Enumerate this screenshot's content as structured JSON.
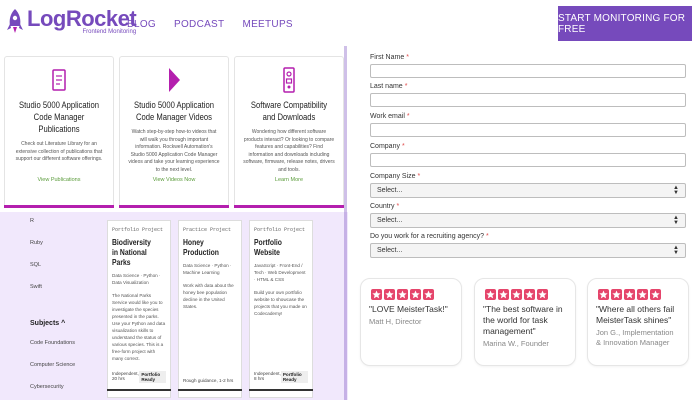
{
  "header": {
    "logo_name": "LogRocket",
    "logo_sub": "Frontend Monitoring",
    "nav": [
      "BLOG",
      "PODCAST",
      "MEETUPS"
    ],
    "cta": "START MONITORING FOR FREE"
  },
  "resource_cards": [
    {
      "icon": "document-icon",
      "title": "Studio 5000 Application Code Manager Publications",
      "desc": "Check out Literature Library for an extensive collection of publications that support our different software offerings.",
      "link": "View Publications"
    },
    {
      "icon": "play-icon",
      "title": "Studio 5000 Application Code Manager Videos",
      "desc": "Watch step-by-step how-to videos that will walk you through important information. Rockwell Automation's Studio 5000 Application Code Manager videos and take your learning experience to the next level.",
      "link": "View Videos Now"
    },
    {
      "icon": "compatibility-icon",
      "title": "Software Compatibility and Downloads",
      "desc": "Wondering how different software products interact? Or looking to compare features and capabilities? Find information and downloads including software, firmware, release notes, drivers and tools.",
      "link": "Learn More"
    }
  ],
  "filters": {
    "items": [
      "R",
      "Ruby",
      "SQL",
      "Swift"
    ],
    "subjects_label": "Subjects ^",
    "subjects": [
      "Code Foundations",
      "Computer Science",
      "Cybersecurity"
    ]
  },
  "projects": [
    {
      "tag": "Portfolio Project",
      "title": "Biodiversity in National Parks",
      "skills": "Data Science · Python · Data Visualization",
      "desc": "The National Parks Service would like you to investigate the species presented in the parks. Use your Python and data visualization skills to understand the status of various species. This is a free-form project with many correct.",
      "footer_left": "Independent, 20 hrs",
      "ready": "Portfolio Ready"
    },
    {
      "tag": "Practice Project",
      "title": "Honey Production",
      "skills": "Data Science · Python · Machine Learning",
      "desc": "Work with data about the honey bee population decline in the United States.",
      "footer_left": "Rough guidance, 1-2 hrs",
      "ready": ""
    },
    {
      "tag": "Portfolio Project",
      "title": "Portfolio Website",
      "skills": "JavaScript · Front-End / Tech · Web Development · HTML & CSS",
      "desc": "Build your own portfolio website to showcase the projects that you made on Codecademy!",
      "footer_left": "Independent, 8 hrs",
      "ready": "Portfolio Ready"
    }
  ],
  "form": {
    "fields": [
      {
        "label": "First Name",
        "type": "text",
        "value": ""
      },
      {
        "label": "Last name",
        "type": "text",
        "value": ""
      },
      {
        "label": "Work email",
        "type": "text",
        "value": ""
      },
      {
        "label": "Company",
        "type": "text",
        "value": ""
      },
      {
        "label": "Company Size",
        "type": "select",
        "value": "Select..."
      },
      {
        "label": "Country",
        "type": "select",
        "value": "Select..."
      },
      {
        "label": "Do you work for a recruiting agency?",
        "type": "select",
        "value": "Select..."
      }
    ],
    "required_mark": "*"
  },
  "testimonials": [
    {
      "quote": "\"LOVE MeisterTask!\"",
      "author": "Matt H, Director",
      "stars": 5
    },
    {
      "quote": "\"The best software in the world for task management\"",
      "author": "Marina W., Founder",
      "stars": 5
    },
    {
      "quote": "\"Where all others fail MeisterTask shines\"",
      "author": "Jon G., Implementation & Innovation Manager",
      "stars": 5
    }
  ],
  "colors": {
    "brand": "#764abc",
    "accent": "#b41fae",
    "star": "#e5456b",
    "panel": "#f1e8fc"
  }
}
